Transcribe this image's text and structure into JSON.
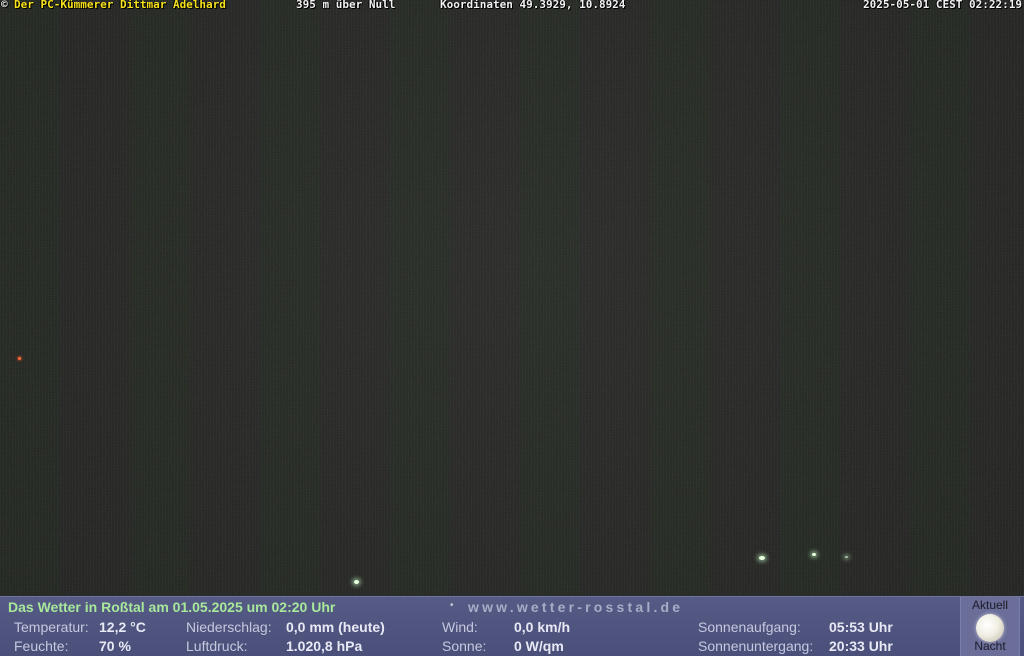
{
  "overlay": {
    "copyright_symbol": "©",
    "author": "Der PC-Kümmerer Dittmar Adelhard",
    "altitude": "395 m über Null",
    "coordinates": "Koordinaten 49.3929, 10.8924",
    "datetime": "2025-05-01 CEST 02:22:19"
  },
  "weather": {
    "title": "Das Wetter in Roßtal am 01.05.2025 um 02:20 Uhr",
    "url_bullet": "•",
    "url": "www.wetter-rosstal.de",
    "temperature_label": "Temperatur:",
    "temperature_value": "12,2 °C",
    "humidity_label": "Feuchte:",
    "humidity_value": "70 %",
    "precip_label": "Niederschlag:",
    "precip_value": "0,0 mm (heute)",
    "pressure_label": "Luftdruck:",
    "pressure_value": "1.020,8 hPa",
    "wind_label": "Wind:",
    "wind_value": "0,0 km/h",
    "sun_label": "Sonne:",
    "sun_value": "0 W/qm",
    "sunrise_label": "Sonnenaufgang:",
    "sunrise_value": "05:53 Uhr",
    "sunset_label": "Sonnenuntergang:",
    "sunset_value": "20:33 Uhr"
  },
  "moon": {
    "top_label": "Aktuell",
    "bottom_label": "Nacht",
    "icon": "full-moon-icon"
  },
  "colors": {
    "author_text": "#f7e21c",
    "overlay_text": "#f2f2f2",
    "weather_bar_bg": "#565b86",
    "weather_title": "#a8e89a",
    "url_text": "#a9acc6"
  }
}
